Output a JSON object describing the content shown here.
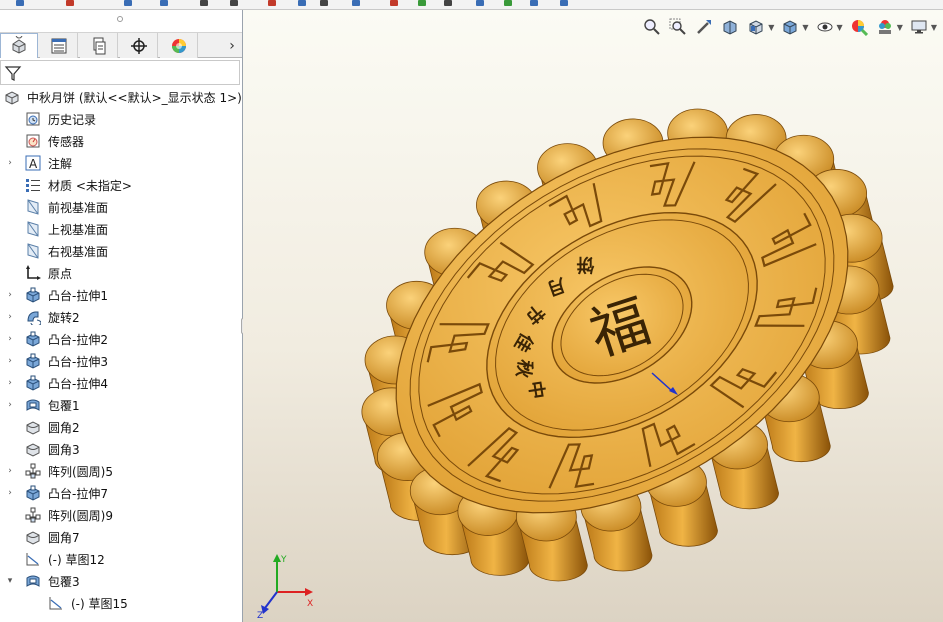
{
  "feature_tree": {
    "root_label": "中秋月饼  (默认<<默认>_显示状态 1>)",
    "items": [
      {
        "label": "历史记录",
        "icon": "history-icon",
        "expandable": false,
        "indent": 1
      },
      {
        "label": "传感器",
        "icon": "sensor-icon",
        "expandable": false,
        "indent": 1
      },
      {
        "label": "注解",
        "icon": "annotation-icon",
        "expandable": true,
        "indent": 1
      },
      {
        "label": "材质 <未指定>",
        "icon": "material-icon",
        "expandable": false,
        "indent": 1
      },
      {
        "label": "前视基准面",
        "icon": "plane-icon",
        "expandable": false,
        "indent": 1
      },
      {
        "label": "上视基准面",
        "icon": "plane-icon",
        "expandable": false,
        "indent": 1
      },
      {
        "label": "右视基准面",
        "icon": "plane-icon",
        "expandable": false,
        "indent": 1
      },
      {
        "label": "原点",
        "icon": "origin-icon",
        "expandable": false,
        "indent": 1
      },
      {
        "label": "凸台-拉伸1",
        "icon": "extrude-icon",
        "expandable": true,
        "indent": 1
      },
      {
        "label": "旋转2",
        "icon": "revolve-icon",
        "expandable": true,
        "indent": 1
      },
      {
        "label": "凸台-拉伸2",
        "icon": "extrude-icon",
        "expandable": true,
        "indent": 1
      },
      {
        "label": "凸台-拉伸3",
        "icon": "extrude-icon",
        "expandable": true,
        "indent": 1
      },
      {
        "label": "凸台-拉伸4",
        "icon": "extrude-icon",
        "expandable": true,
        "indent": 1
      },
      {
        "label": "包覆1",
        "icon": "wrap-icon",
        "expandable": true,
        "indent": 1
      },
      {
        "label": "圆角2",
        "icon": "fillet-icon",
        "expandable": false,
        "indent": 1
      },
      {
        "label": "圆角3",
        "icon": "fillet-icon",
        "expandable": false,
        "indent": 1
      },
      {
        "label": "阵列(圆周)5",
        "icon": "circular-pattern-icon",
        "expandable": true,
        "indent": 1
      },
      {
        "label": "凸台-拉伸7",
        "icon": "extrude-icon",
        "expandable": true,
        "indent": 1
      },
      {
        "label": "阵列(圆周)9",
        "icon": "circular-pattern-icon",
        "expandable": false,
        "indent": 1
      },
      {
        "label": "圆角7",
        "icon": "fillet-icon",
        "expandable": false,
        "indent": 1
      },
      {
        "label": "(-) 草图12",
        "icon": "sketch-icon",
        "expandable": false,
        "indent": 1
      },
      {
        "label": "包覆3",
        "icon": "wrap-icon",
        "expandable": true,
        "expanded": true,
        "indent": 1
      },
      {
        "label": "(-) 草图15",
        "icon": "sketch-icon",
        "expandable": false,
        "indent": 2
      }
    ]
  },
  "panel_tabs": [
    "featuremanager-icon",
    "propertymanager-icon",
    "configurationmanager-icon",
    "dimxpert-icon",
    "display-manager-icon"
  ],
  "model": {
    "center_character": "福",
    "ring_text": "中秋佳节月饼",
    "body_color": "#e8a63a",
    "face_color": "#f2b84b",
    "edge_color": "#7a4a0a"
  },
  "heads_up_toolbar": [
    "zoom-to-fit-icon",
    "zoom-to-area-icon",
    "previous-view-icon",
    "section-view-icon",
    "view-orientation-icon",
    "display-style-icon",
    "hide-show-icon",
    "edit-appearance-icon",
    "apply-scene-icon",
    "view-settings-icon"
  ],
  "triad": {
    "x": "X",
    "y": "Y",
    "z": "Z"
  }
}
